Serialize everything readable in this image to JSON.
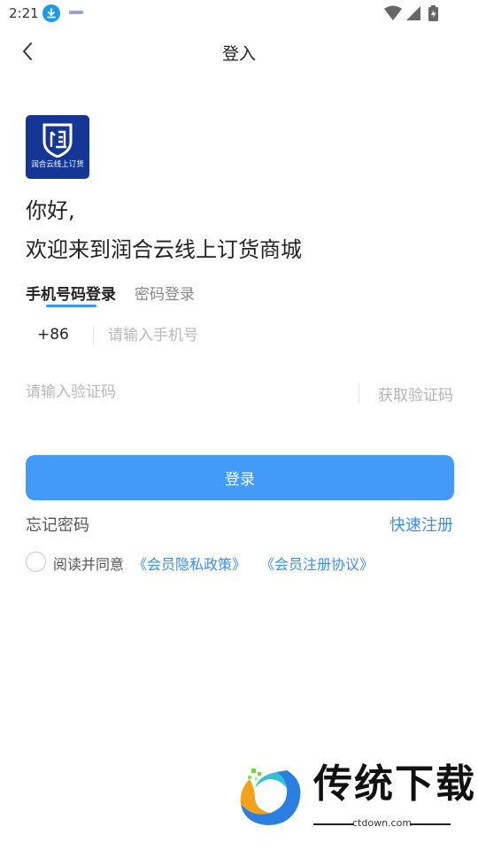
{
  "status_bar": {
    "time": "2:21",
    "icons": [
      "download-icon",
      "notification-icon",
      "wifi-icon",
      "signal-icon",
      "battery-icon"
    ]
  },
  "nav": {
    "title": "登入",
    "back_icon": "chevron-left-icon"
  },
  "logo": {
    "text": "润合云线上订货",
    "bg_color": "#143796"
  },
  "greeting": {
    "line1": "你好,",
    "line2": "欢迎来到润合云线上订货商城"
  },
  "tabs": [
    {
      "label": "手机号码登录",
      "active": true
    },
    {
      "label": "密码登录",
      "active": false
    }
  ],
  "phone": {
    "country_code": "+86",
    "placeholder": "请输入手机号",
    "value": ""
  },
  "code": {
    "placeholder": "请输入验证码",
    "value": "",
    "get_code_label": "获取验证码"
  },
  "login_button": {
    "label": "登录",
    "color": "#449bf7"
  },
  "links": {
    "forgot": "忘记密码",
    "register": "快速注册"
  },
  "agreement": {
    "prefix": "阅读并同意",
    "privacy": "《会员隐私政策》",
    "terms": "《会员注册协议》",
    "checked": false
  },
  "watermark": {
    "title": "传统下载",
    "url": "ctdown.com"
  },
  "colors": {
    "accent": "#3d94f4",
    "link": "#3d8fe8"
  }
}
